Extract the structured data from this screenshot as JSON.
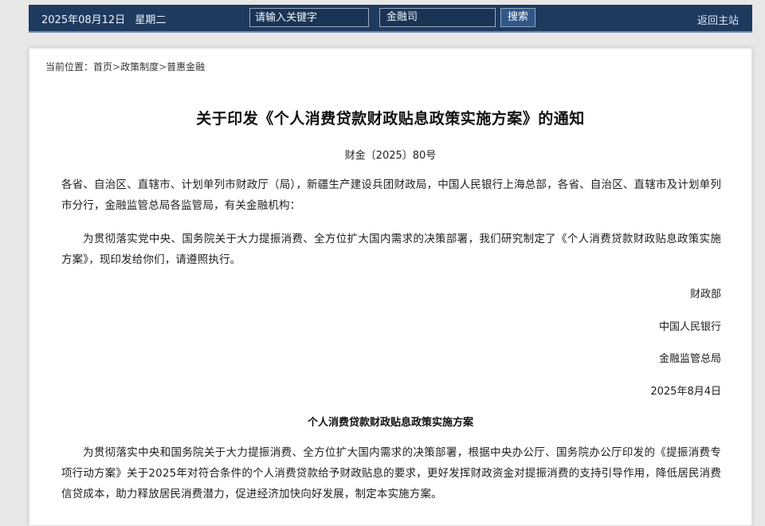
{
  "header": {
    "date": "2025年08月12日",
    "weekday": "星期二",
    "search": {
      "placeholder": "请输入关键字"
    },
    "scope_select": {
      "selected": "金融司"
    },
    "search_button": "搜索",
    "home_link": "返回主站",
    "colors": {
      "bar": "#1f3a5f",
      "button": "#2f5888"
    }
  },
  "breadcrumb": {
    "prefix": "当前位置：",
    "items": [
      "首页",
      "政策制度",
      "普惠金融"
    ],
    "separator": ">"
  },
  "document": {
    "title": "关于印发《个人消费贷款财政贴息政策实施方案》的通知",
    "number": "财金〔2025〕80号",
    "addressees": "各省、自治区、直辖市、计划单列市财政厅（局），新疆生产建设兵团财政局，中国人民银行上海总部，各省、自治区、直辖市及计划单列市分行，金融监管总局各监管局，有关金融机构：",
    "body": "为贯彻落实党中央、国务院关于大力提振消费、全方位扩大国内需求的决策部署，我们研究制定了《个人消费贷款财政贴息政策实施方案》，现印发给你们，请遵照执行。",
    "signatories": [
      "财政部",
      "中国人民银行",
      "金融监管总局"
    ],
    "date": "2025年8月4日"
  },
  "plan": {
    "title": "个人消费贷款财政贴息政策实施方案",
    "intro": "为贯彻落实中央和国务院关于大力提振消费、全方位扩大国内需求的决策部署，根据中央办公厅、国务院办公厅印发的《提振消费专项行动方案》关于2025年对符合条件的个人消费贷款给予财政贴息的要求，更好发挥财政资金对提振消费的支持引导作用，降低居民消费信贷成本，助力释放居民消费潜力，促进经济加快向好发展，制定本实施方案。"
  }
}
